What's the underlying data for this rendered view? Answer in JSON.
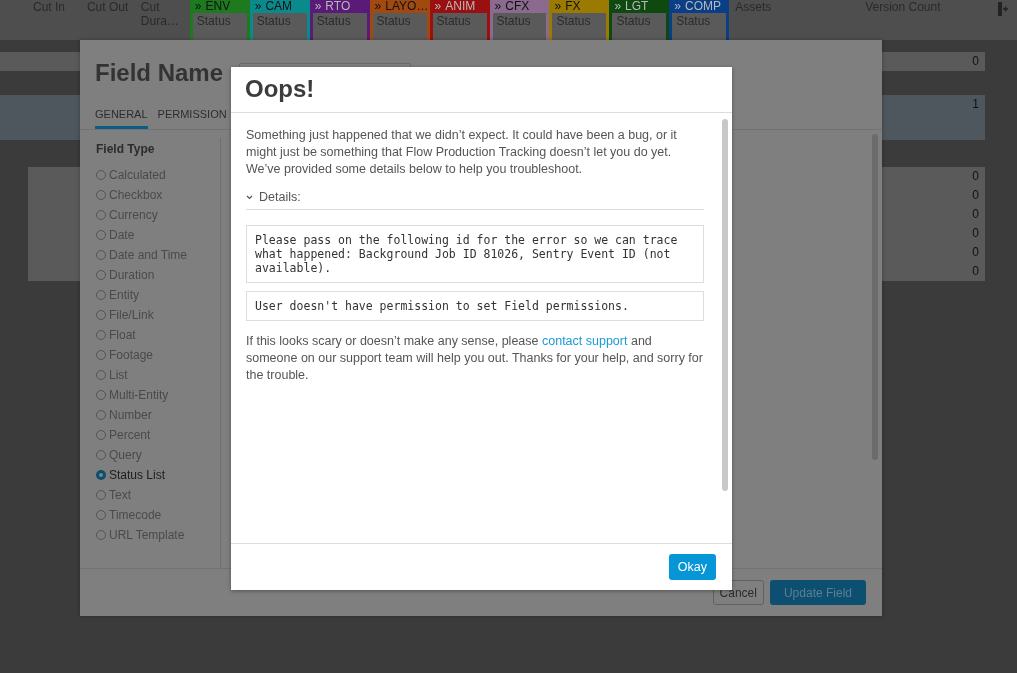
{
  "grid": {
    "columns": [
      {
        "label": "Cut In",
        "kind": "plain"
      },
      {
        "label": "Cut Out",
        "kind": "plain"
      },
      {
        "label": "Cut Dura…",
        "kind": "plain"
      },
      {
        "label": "ENV",
        "sub": "Status",
        "kind": "step",
        "color": "#1e7a1e"
      },
      {
        "label": "CAM",
        "sub": "Status",
        "kind": "step",
        "color": "#0a8a8c"
      },
      {
        "label": "RTO",
        "sub": "Status",
        "kind": "step",
        "color": "#5a1a78"
      },
      {
        "label": "LAYO…",
        "sub": "Status",
        "kind": "step",
        "color": "#a04a10"
      },
      {
        "label": "ANIM",
        "sub": "Status",
        "kind": "step",
        "color": "#9a1010"
      },
      {
        "label": "CFX",
        "sub": "Status",
        "kind": "step",
        "color": "#8a6a8e"
      },
      {
        "label": "FX",
        "sub": "Status",
        "kind": "step",
        "color": "#9a7a00"
      },
      {
        "label": "LGT",
        "sub": "Status",
        "kind": "step",
        "color": "#0e4a10"
      },
      {
        "label": "COMP",
        "sub": "Status",
        "kind": "step",
        "color": "#0a3e86"
      },
      {
        "label": "Assets",
        "kind": "wide"
      },
      {
        "label": "Version Count",
        "kind": "wide"
      }
    ],
    "step_glyph": "»",
    "rows": [
      {
        "value": "0",
        "selected": false
      },
      {
        "value": "1",
        "selected": true
      },
      {
        "value": "0",
        "selected": false
      },
      {
        "value": "0",
        "selected": false
      },
      {
        "value": "0",
        "selected": false
      },
      {
        "value": "0",
        "selected": false
      },
      {
        "value": "0",
        "selected": false
      },
      {
        "value": "0",
        "selected": false
      }
    ]
  },
  "field_dialog": {
    "title": "Field Name",
    "tabs": [
      {
        "label": "GENERAL",
        "selected": true
      },
      {
        "label": "PERMISSION",
        "selected": false
      }
    ],
    "section_title": "Field Type",
    "field_types": [
      {
        "label": "Calculated",
        "selected": false
      },
      {
        "label": "Checkbox",
        "selected": false
      },
      {
        "label": "Currency",
        "selected": false
      },
      {
        "label": "Date",
        "selected": false
      },
      {
        "label": "Date and Time",
        "selected": false
      },
      {
        "label": "Duration",
        "selected": false
      },
      {
        "label": "Entity",
        "selected": false
      },
      {
        "label": "File/Link",
        "selected": false
      },
      {
        "label": "Float",
        "selected": false
      },
      {
        "label": "Footage",
        "selected": false
      },
      {
        "label": "List",
        "selected": false
      },
      {
        "label": "Multi-Entity",
        "selected": false
      },
      {
        "label": "Number",
        "selected": false
      },
      {
        "label": "Percent",
        "selected": false
      },
      {
        "label": "Query",
        "selected": false
      },
      {
        "label": "Status List",
        "selected": true
      },
      {
        "label": "Text",
        "selected": false
      },
      {
        "label": "Timecode",
        "selected": false
      },
      {
        "label": "URL Template",
        "selected": false
      }
    ],
    "buttons": [
      {
        "label": "Cancel",
        "kind": "secondary"
      },
      {
        "label": "Update Field",
        "kind": "primary"
      }
    ]
  },
  "error_dialog": {
    "title": "Oops!",
    "intro": "Something just happened that we didn’t expect. It could have been a bug, or it might just be something that Flow Production Tracking doesn’t let you do yet. We’ve provided some details below to help you troubleshoot.",
    "details": {
      "label": "Details:",
      "expanded": true,
      "messages": [
        "Please pass on the following id for the error so we can trace what happened: Background Job ID 81026, Sentry Event ID (not available).",
        "User doesn't have permission to set Field permissions."
      ]
    },
    "outro_before": "If this looks scary or doesn’t make any sense, please ",
    "outro_link": "contact support",
    "outro_after": " and someone on our support team will help you out. Thanks for your help, and sorry for the trouble.",
    "button": "Okay"
  }
}
